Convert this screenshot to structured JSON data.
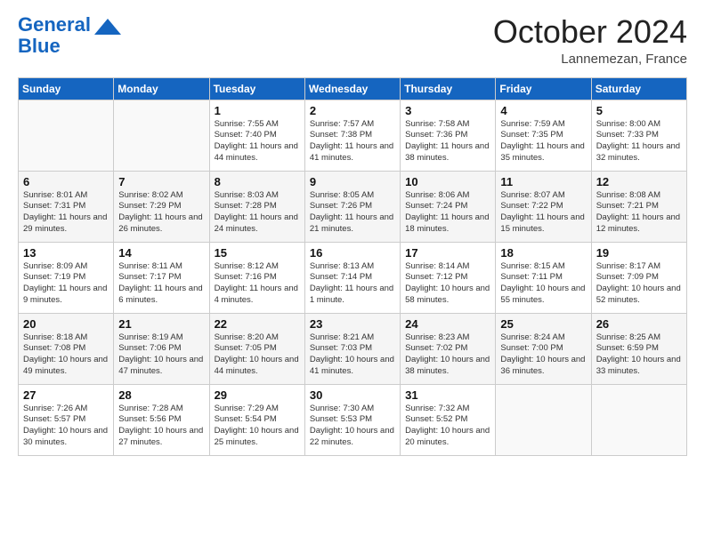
{
  "logo": {
    "line1": "General",
    "line2": "Blue"
  },
  "header": {
    "month": "October 2024",
    "location": "Lannemezan, France"
  },
  "weekdays": [
    "Sunday",
    "Monday",
    "Tuesday",
    "Wednesday",
    "Thursday",
    "Friday",
    "Saturday"
  ],
  "weeks": [
    [
      {
        "day": "",
        "info": ""
      },
      {
        "day": "",
        "info": ""
      },
      {
        "day": "1",
        "info": "Sunrise: 7:55 AM\nSunset: 7:40 PM\nDaylight: 11 hours and 44 minutes."
      },
      {
        "day": "2",
        "info": "Sunrise: 7:57 AM\nSunset: 7:38 PM\nDaylight: 11 hours and 41 minutes."
      },
      {
        "day": "3",
        "info": "Sunrise: 7:58 AM\nSunset: 7:36 PM\nDaylight: 11 hours and 38 minutes."
      },
      {
        "day": "4",
        "info": "Sunrise: 7:59 AM\nSunset: 7:35 PM\nDaylight: 11 hours and 35 minutes."
      },
      {
        "day": "5",
        "info": "Sunrise: 8:00 AM\nSunset: 7:33 PM\nDaylight: 11 hours and 32 minutes."
      }
    ],
    [
      {
        "day": "6",
        "info": "Sunrise: 8:01 AM\nSunset: 7:31 PM\nDaylight: 11 hours and 29 minutes."
      },
      {
        "day": "7",
        "info": "Sunrise: 8:02 AM\nSunset: 7:29 PM\nDaylight: 11 hours and 26 minutes."
      },
      {
        "day": "8",
        "info": "Sunrise: 8:03 AM\nSunset: 7:28 PM\nDaylight: 11 hours and 24 minutes."
      },
      {
        "day": "9",
        "info": "Sunrise: 8:05 AM\nSunset: 7:26 PM\nDaylight: 11 hours and 21 minutes."
      },
      {
        "day": "10",
        "info": "Sunrise: 8:06 AM\nSunset: 7:24 PM\nDaylight: 11 hours and 18 minutes."
      },
      {
        "day": "11",
        "info": "Sunrise: 8:07 AM\nSunset: 7:22 PM\nDaylight: 11 hours and 15 minutes."
      },
      {
        "day": "12",
        "info": "Sunrise: 8:08 AM\nSunset: 7:21 PM\nDaylight: 11 hours and 12 minutes."
      }
    ],
    [
      {
        "day": "13",
        "info": "Sunrise: 8:09 AM\nSunset: 7:19 PM\nDaylight: 11 hours and 9 minutes."
      },
      {
        "day": "14",
        "info": "Sunrise: 8:11 AM\nSunset: 7:17 PM\nDaylight: 11 hours and 6 minutes."
      },
      {
        "day": "15",
        "info": "Sunrise: 8:12 AM\nSunset: 7:16 PM\nDaylight: 11 hours and 4 minutes."
      },
      {
        "day": "16",
        "info": "Sunrise: 8:13 AM\nSunset: 7:14 PM\nDaylight: 11 hours and 1 minute."
      },
      {
        "day": "17",
        "info": "Sunrise: 8:14 AM\nSunset: 7:12 PM\nDaylight: 10 hours and 58 minutes."
      },
      {
        "day": "18",
        "info": "Sunrise: 8:15 AM\nSunset: 7:11 PM\nDaylight: 10 hours and 55 minutes."
      },
      {
        "day": "19",
        "info": "Sunrise: 8:17 AM\nSunset: 7:09 PM\nDaylight: 10 hours and 52 minutes."
      }
    ],
    [
      {
        "day": "20",
        "info": "Sunrise: 8:18 AM\nSunset: 7:08 PM\nDaylight: 10 hours and 49 minutes."
      },
      {
        "day": "21",
        "info": "Sunrise: 8:19 AM\nSunset: 7:06 PM\nDaylight: 10 hours and 47 minutes."
      },
      {
        "day": "22",
        "info": "Sunrise: 8:20 AM\nSunset: 7:05 PM\nDaylight: 10 hours and 44 minutes."
      },
      {
        "day": "23",
        "info": "Sunrise: 8:21 AM\nSunset: 7:03 PM\nDaylight: 10 hours and 41 minutes."
      },
      {
        "day": "24",
        "info": "Sunrise: 8:23 AM\nSunset: 7:02 PM\nDaylight: 10 hours and 38 minutes."
      },
      {
        "day": "25",
        "info": "Sunrise: 8:24 AM\nSunset: 7:00 PM\nDaylight: 10 hours and 36 minutes."
      },
      {
        "day": "26",
        "info": "Sunrise: 8:25 AM\nSunset: 6:59 PM\nDaylight: 10 hours and 33 minutes."
      }
    ],
    [
      {
        "day": "27",
        "info": "Sunrise: 7:26 AM\nSunset: 5:57 PM\nDaylight: 10 hours and 30 minutes."
      },
      {
        "day": "28",
        "info": "Sunrise: 7:28 AM\nSunset: 5:56 PM\nDaylight: 10 hours and 27 minutes."
      },
      {
        "day": "29",
        "info": "Sunrise: 7:29 AM\nSunset: 5:54 PM\nDaylight: 10 hours and 25 minutes."
      },
      {
        "day": "30",
        "info": "Sunrise: 7:30 AM\nSunset: 5:53 PM\nDaylight: 10 hours and 22 minutes."
      },
      {
        "day": "31",
        "info": "Sunrise: 7:32 AM\nSunset: 5:52 PM\nDaylight: 10 hours and 20 minutes."
      },
      {
        "day": "",
        "info": ""
      },
      {
        "day": "",
        "info": ""
      }
    ]
  ]
}
